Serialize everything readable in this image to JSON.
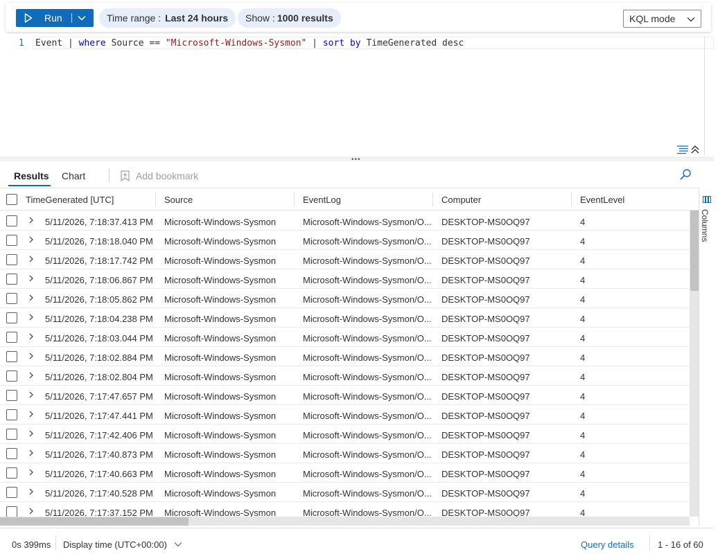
{
  "toolbar": {
    "run_label": "Run",
    "time_range_label": "Time range :",
    "time_range_value": "Last 24 hours",
    "show_label": "Show :",
    "show_value": "1000 results",
    "mode": "KQL mode"
  },
  "editor": {
    "line_number": "1",
    "query_parts": {
      "p1": "Event | ",
      "k1": "where",
      "p2": " Source == ",
      "s1": "\"Microsoft-Windows-Sysmon\"",
      "p3": " | ",
      "k2": "sort by",
      "p4": " TimeGenerated desc"
    }
  },
  "tabs": {
    "results": "Results",
    "chart": "Chart",
    "add_bookmark": "Add bookmark"
  },
  "table": {
    "columns": [
      "TimeGenerated [UTC]",
      "Source",
      "EventLog",
      "Computer",
      "EventLevel"
    ],
    "rows": [
      [
        "5/11/2026, 7:18:37.413 PM",
        "Microsoft-Windows-Sysmon",
        "Microsoft-Windows-Sysmon/O...",
        "DESKTOP-MS0OQ97",
        "4"
      ],
      [
        "5/11/2026, 7:18:18.040 PM",
        "Microsoft-Windows-Sysmon",
        "Microsoft-Windows-Sysmon/O...",
        "DESKTOP-MS0OQ97",
        "4"
      ],
      [
        "5/11/2026, 7:18:17.742 PM",
        "Microsoft-Windows-Sysmon",
        "Microsoft-Windows-Sysmon/O...",
        "DESKTOP-MS0OQ97",
        "4"
      ],
      [
        "5/11/2026, 7:18:06.867 PM",
        "Microsoft-Windows-Sysmon",
        "Microsoft-Windows-Sysmon/O...",
        "DESKTOP-MS0OQ97",
        "4"
      ],
      [
        "5/11/2026, 7:18:05.862 PM",
        "Microsoft-Windows-Sysmon",
        "Microsoft-Windows-Sysmon/O...",
        "DESKTOP-MS0OQ97",
        "4"
      ],
      [
        "5/11/2026, 7:18:04.238 PM",
        "Microsoft-Windows-Sysmon",
        "Microsoft-Windows-Sysmon/O...",
        "DESKTOP-MS0OQ97",
        "4"
      ],
      [
        "5/11/2026, 7:18:03.044 PM",
        "Microsoft-Windows-Sysmon",
        "Microsoft-Windows-Sysmon/O...",
        "DESKTOP-MS0OQ97",
        "4"
      ],
      [
        "5/11/2026, 7:18:02.884 PM",
        "Microsoft-Windows-Sysmon",
        "Microsoft-Windows-Sysmon/O...",
        "DESKTOP-MS0OQ97",
        "4"
      ],
      [
        "5/11/2026, 7:18:02.804 PM",
        "Microsoft-Windows-Sysmon",
        "Microsoft-Windows-Sysmon/O...",
        "DESKTOP-MS0OQ97",
        "4"
      ],
      [
        "5/11/2026, 7:17:47.657 PM",
        "Microsoft-Windows-Sysmon",
        "Microsoft-Windows-Sysmon/O...",
        "DESKTOP-MS0OQ97",
        "4"
      ],
      [
        "5/11/2026, 7:17:47.441 PM",
        "Microsoft-Windows-Sysmon",
        "Microsoft-Windows-Sysmon/O...",
        "DESKTOP-MS0OQ97",
        "4"
      ],
      [
        "5/11/2026, 7:17:42.406 PM",
        "Microsoft-Windows-Sysmon",
        "Microsoft-Windows-Sysmon/O...",
        "DESKTOP-MS0OQ97",
        "4"
      ],
      [
        "5/11/2026, 7:17:40.873 PM",
        "Microsoft-Windows-Sysmon",
        "Microsoft-Windows-Sysmon/O...",
        "DESKTOP-MS0OQ97",
        "4"
      ],
      [
        "5/11/2026, 7:17:40.663 PM",
        "Microsoft-Windows-Sysmon",
        "Microsoft-Windows-Sysmon/O...",
        "DESKTOP-MS0OQ97",
        "4"
      ],
      [
        "5/11/2026, 7:17:40.528 PM",
        "Microsoft-Windows-Sysmon",
        "Microsoft-Windows-Sysmon/O...",
        "DESKTOP-MS0OQ97",
        "4"
      ],
      [
        "5/11/2026, 7:17:37.152 PM",
        "Microsoft-Windows-Sysmon",
        "Microsoft-Windows-Sysmon/O...",
        "DESKTOP-MS0OQ97",
        "4"
      ]
    ]
  },
  "side_panel": {
    "columns_label": "Columns"
  },
  "footer": {
    "duration": "0s 399ms",
    "display_time": "Display time (UTC+00:00)",
    "query_details": "Query details",
    "pagination": "1 - 16 of 60"
  },
  "colors": {
    "accent": "#0f6cbd",
    "pill_bg": "#e5eefa",
    "keyword": "#0000ff",
    "string": "#a31515"
  }
}
